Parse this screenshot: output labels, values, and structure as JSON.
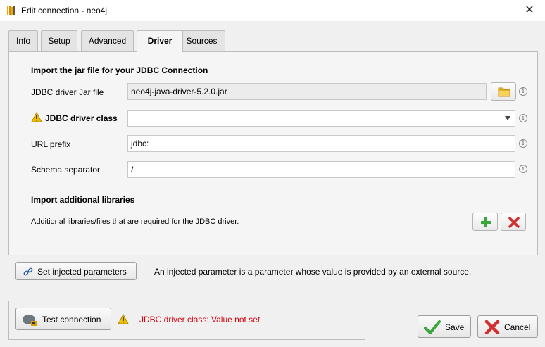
{
  "window": {
    "title": "Edit connection - neo4j",
    "close_icon": "close-icon",
    "app_icon": "app-icon"
  },
  "tabs": [
    {
      "label": "Info",
      "active": false
    },
    {
      "label": "Setup",
      "active": false
    },
    {
      "label": "Advanced",
      "active": false
    },
    {
      "label": "Driver",
      "active": true
    },
    {
      "label": "Sources",
      "active": false
    }
  ],
  "driver": {
    "import_title": "Import the jar file for your JDBC Connection",
    "jar_label": "JDBC driver Jar file",
    "jar_value": "neo4j-java-driver-5.2.0.jar",
    "class_label": "JDBC driver class",
    "class_value": "",
    "url_prefix_label": "URL prefix",
    "url_prefix_value": "jdbc:",
    "schema_sep_label": "Schema separator",
    "schema_sep_value": "/",
    "libraries_title": "Import additional libraries",
    "libraries_desc": "Additional libraries/files that are required for the JDBC driver.",
    "info_glyph": "i"
  },
  "injected": {
    "button_label": "Set injected parameters",
    "description": "An injected parameter is a parameter whose value is provided by an external source."
  },
  "test": {
    "button_label": "Test connection",
    "error": "JDBC driver class: Value not set"
  },
  "footer": {
    "save_label": "Save",
    "cancel_label": "Cancel"
  },
  "colors": {
    "error": "#d8000c",
    "warning": "#f2c200",
    "add": "#3aa53a",
    "remove": "#d32f2f"
  }
}
